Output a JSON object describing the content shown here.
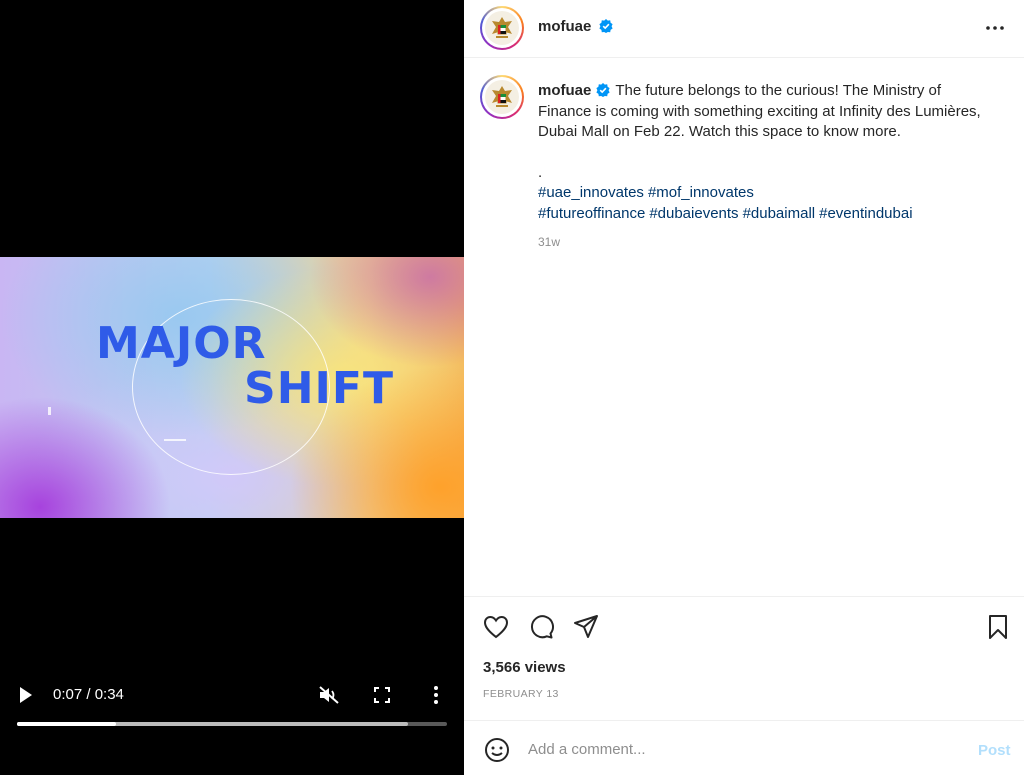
{
  "video": {
    "title_line1": "MAJOR",
    "title_line2": "SHIFT",
    "time_display": "0:07 / 0:34",
    "progress_fraction": 0.23,
    "buffered_fraction": 0.91,
    "muted": true,
    "icons": [
      "play-icon",
      "mute-icon",
      "fullscreen-icon",
      "more-vertical-icon"
    ]
  },
  "post": {
    "username": "mofuae",
    "verified": true,
    "caption": "The future belongs to the curious! The Ministry of Finance is coming with something exciting at Infinity des Lumières, Dubai Mall on Feb 22. Watch this space to know more.",
    "separator": ".",
    "hashtags_line1": [
      "#uae_innovates",
      "#mof_innovates"
    ],
    "hashtags_line2": [
      "#futureoffinance",
      "#dubaievents",
      "#dubaimall",
      "#eventindubai"
    ],
    "age": "31w",
    "views": "3,566 views",
    "date": "FEBRUARY 13"
  },
  "comment": {
    "placeholder": "Add a comment...",
    "post_label": "Post"
  },
  "colors": {
    "accent_blue": "#0095f6",
    "hashtag": "#00376b",
    "muted_text": "#8e8e8e",
    "post_disabled": "#b2dffc",
    "video_title": "#2f5be8"
  }
}
